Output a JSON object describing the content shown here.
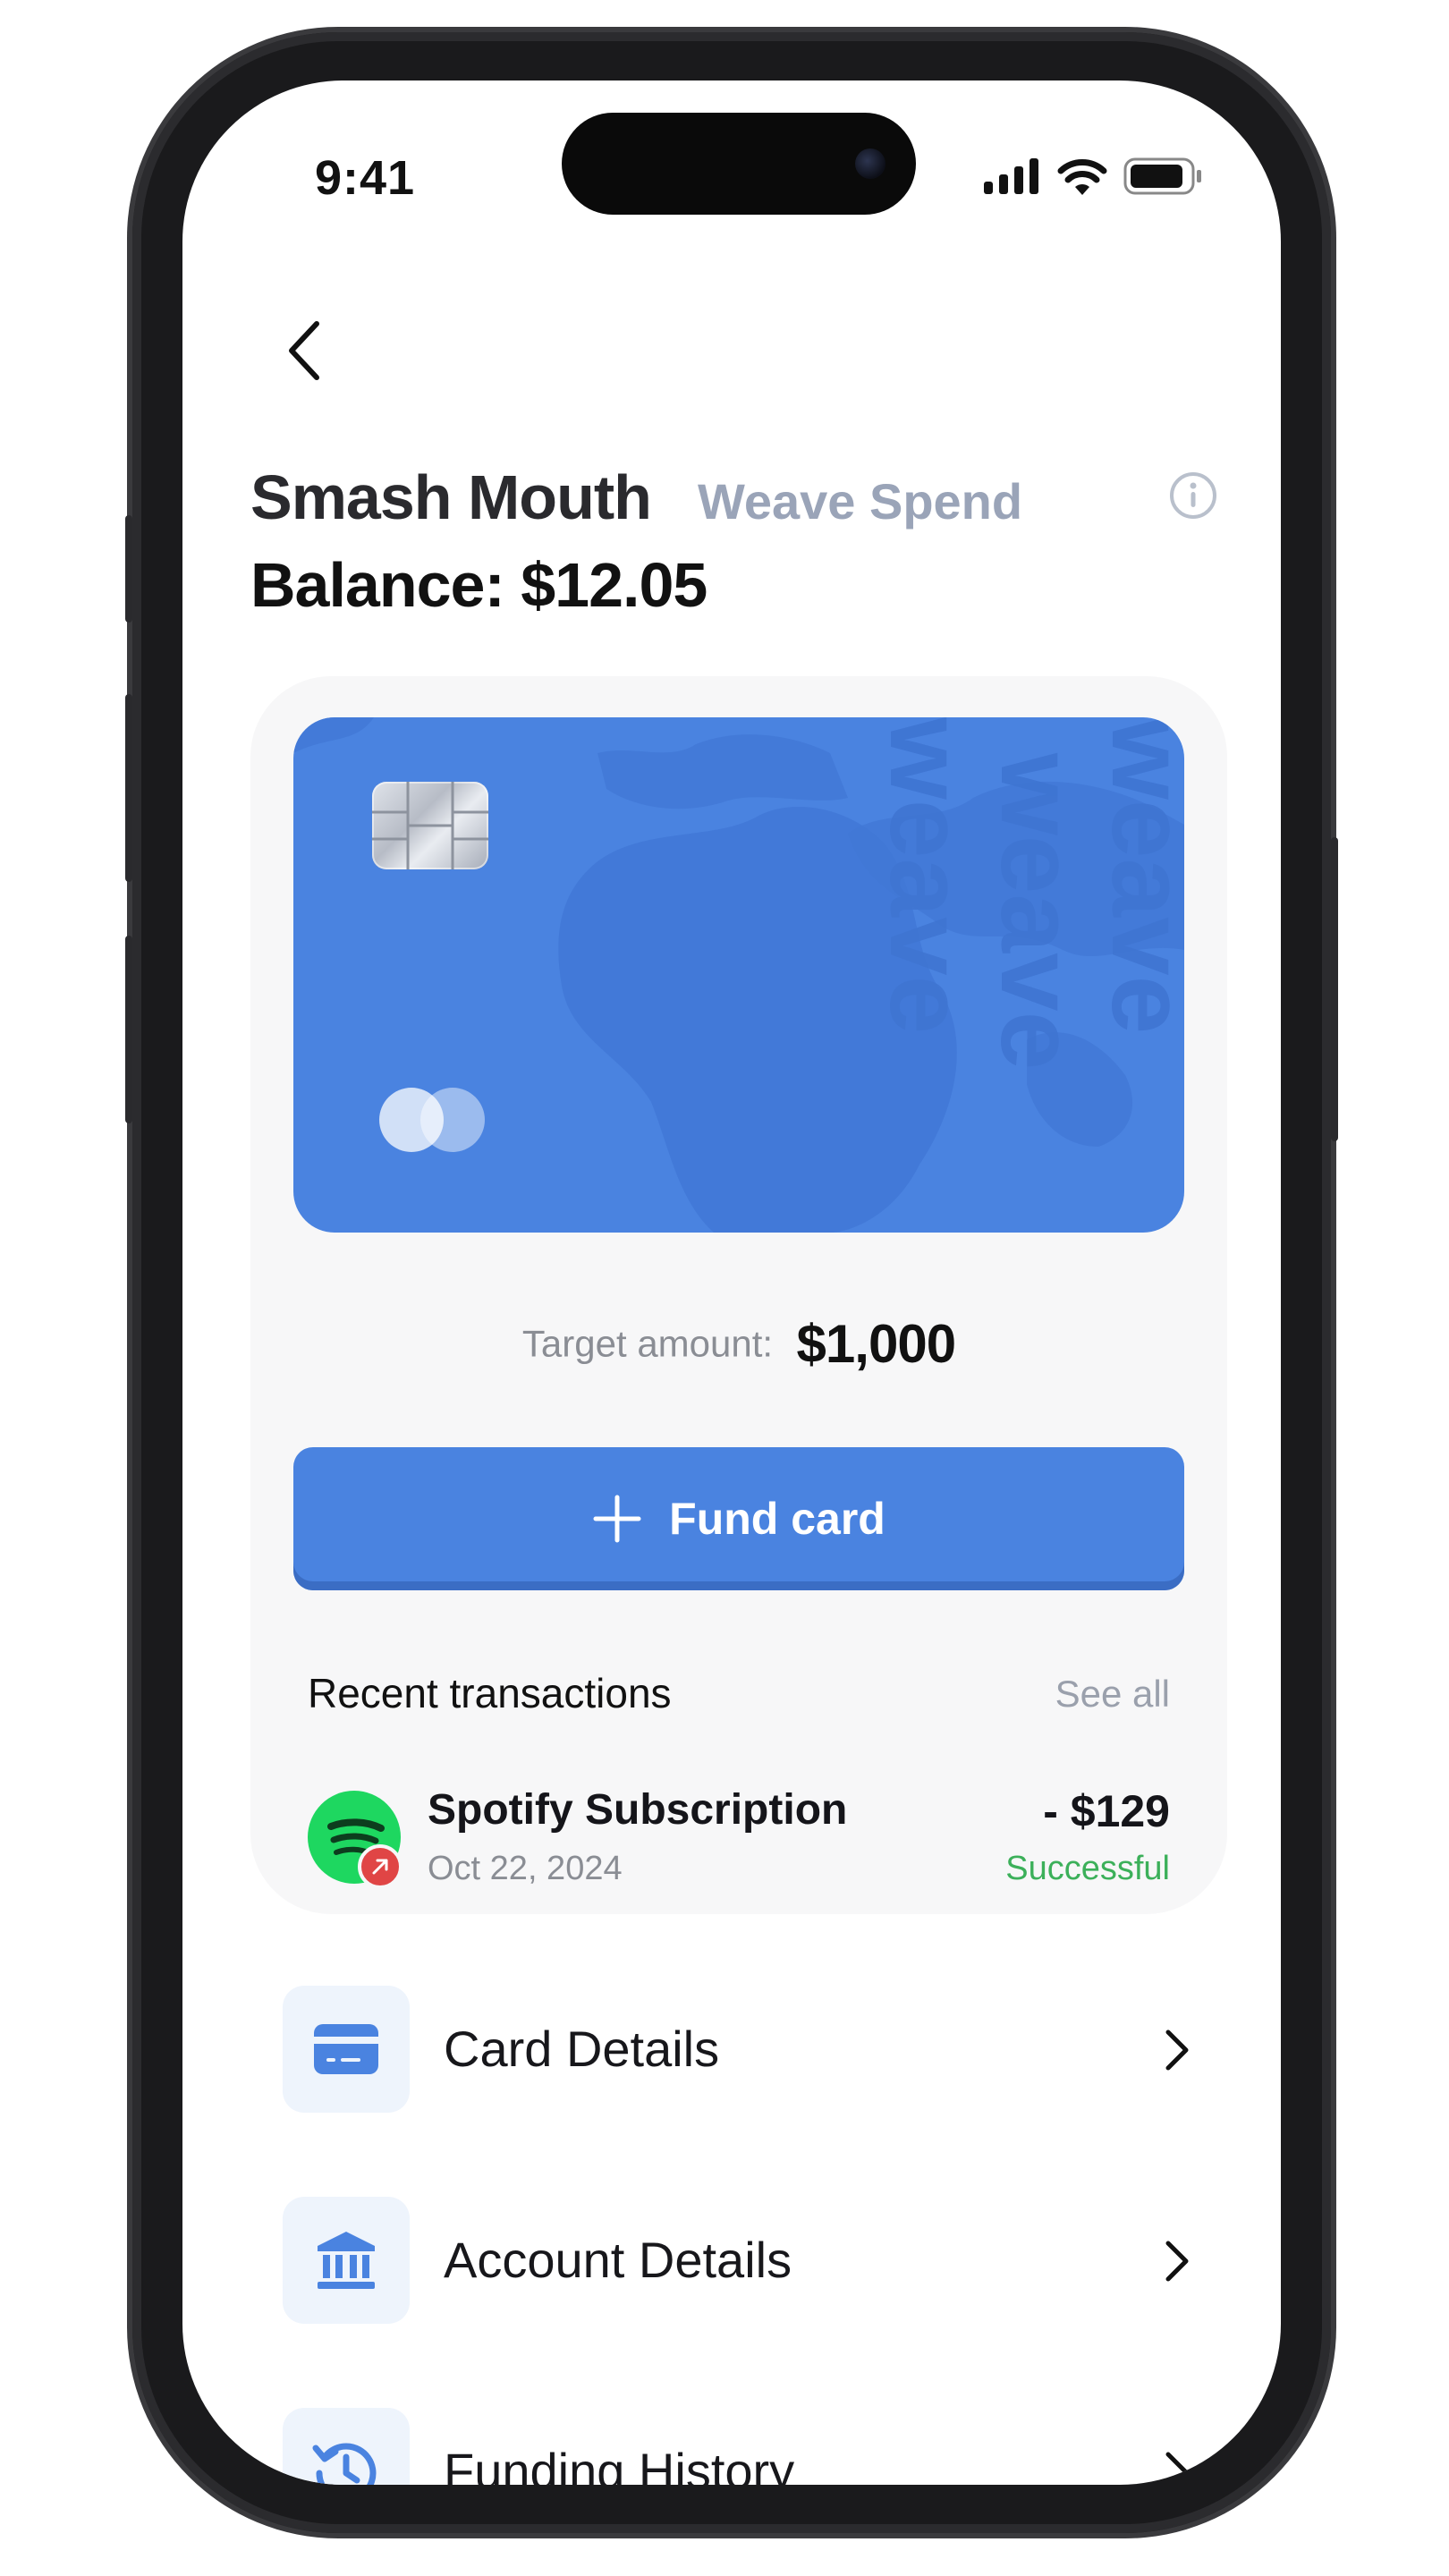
{
  "status_bar": {
    "time": "9:41"
  },
  "header": {
    "name": "Smash Mouth",
    "subtitle": "Weave Spend",
    "balance": "Balance: $12.05"
  },
  "card": {
    "brand_watermark": "weave",
    "target_label": "Target amount:",
    "target_value": "$1,000"
  },
  "fund_button": {
    "label": "Fund card"
  },
  "recent": {
    "title": "Recent transactions",
    "see_all": "See all",
    "transactions": [
      {
        "name": "Spotify Subscription",
        "date": "Oct 22, 2024",
        "amount": "- $129",
        "status": "Successful"
      }
    ]
  },
  "menu": {
    "items": [
      {
        "label": "Card Details",
        "icon": "card-icon"
      },
      {
        "label": "Account Details",
        "icon": "bank-icon"
      },
      {
        "label": "Funding History",
        "icon": "history-icon"
      }
    ]
  },
  "colors": {
    "accent": "#4a83e0",
    "success": "#3cb05a",
    "spotify": "#1ed760"
  }
}
